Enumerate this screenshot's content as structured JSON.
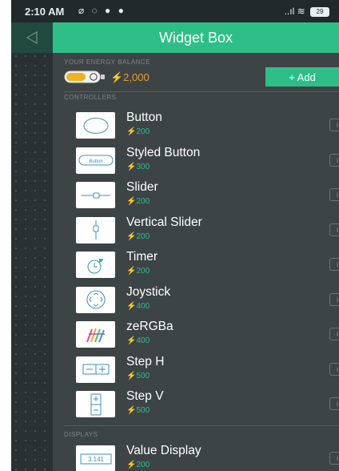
{
  "status_bar": {
    "time": "2:10 AM",
    "notification_icons": "⌀ ◌ ● ●",
    "signal_icons": "..ıl ≋",
    "battery": "29"
  },
  "header": {
    "title": "Widget Box",
    "back_icon": "back-arrow-icon"
  },
  "energy": {
    "section_label": "YOUR ENERGY BALANCE",
    "value": "⚡2,000",
    "add_label": "+ Add"
  },
  "controllers": {
    "section_label": "CONTROLLERS",
    "items": [
      {
        "name": "Button",
        "cost": "⚡200",
        "icon": "button-icon"
      },
      {
        "name": "Styled Button",
        "cost": "⚡300",
        "icon": "styled-button-icon",
        "thumb_text": "Button"
      },
      {
        "name": "Slider",
        "cost": "⚡200",
        "icon": "slider-icon"
      },
      {
        "name": "Vertical Slider",
        "cost": "⚡200",
        "icon": "vertical-slider-icon"
      },
      {
        "name": "Timer",
        "cost": "⚡200",
        "icon": "timer-icon"
      },
      {
        "name": "Joystick",
        "cost": "⚡400",
        "icon": "joystick-icon"
      },
      {
        "name": "zeRGBa",
        "cost": "⚡400",
        "icon": "zergba-icon"
      },
      {
        "name": "Step H",
        "cost": "⚡500",
        "icon": "step-h-icon"
      },
      {
        "name": "Step V",
        "cost": "⚡500",
        "icon": "step-v-icon"
      }
    ]
  },
  "displays": {
    "section_label": "DISPLAYS",
    "items": [
      {
        "name": "Value Display",
        "cost": "⚡200",
        "icon": "value-display-icon",
        "thumb_text": "3.141"
      }
    ]
  },
  "colors": {
    "accent": "#2dbf87",
    "energy": "#e89e2f",
    "background": "#3d4446",
    "status_bar": "#22292b"
  }
}
